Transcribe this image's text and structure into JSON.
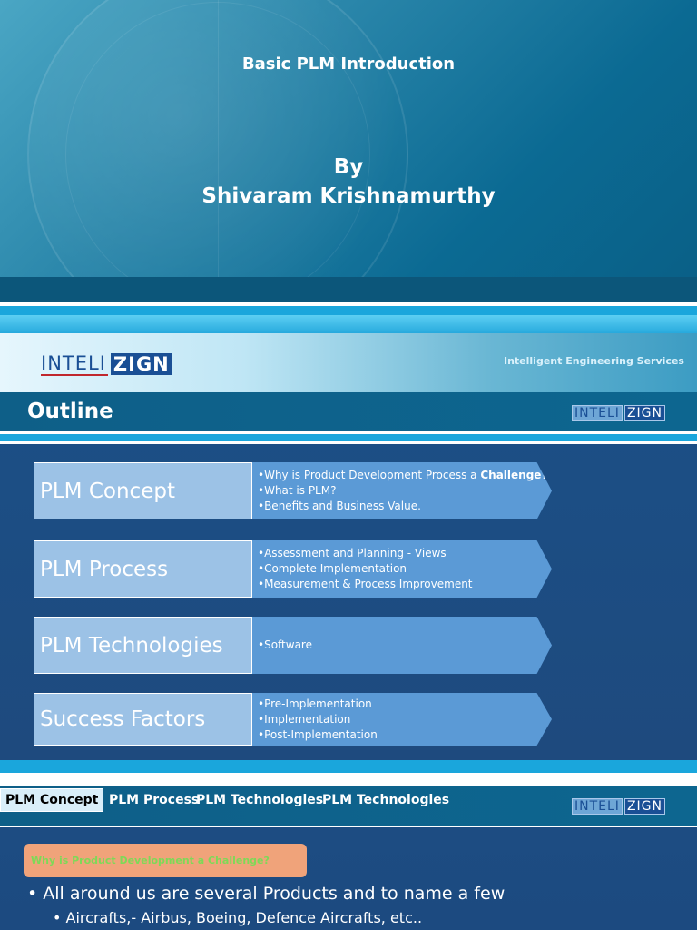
{
  "slide1": {
    "title": "Basic PLM Introduction",
    "by_label": "By",
    "author": "Shivaram Krishnamurthy"
  },
  "slide2": {
    "logo_left": "INTELI",
    "logo_right": "ZIGN",
    "tagline": "Intelligent Engineering Services",
    "title": "Outline",
    "rows": [
      {
        "label": "PLM Concept",
        "bullets": [
          {
            "pre": "•Why is Product Development Process a ",
            "bold": "Challenge",
            "post": "?"
          },
          {
            "pre": "•What is PLM?",
            "bold": "",
            "post": ""
          },
          {
            "pre": "•Benefits and Business Value.",
            "bold": "",
            "post": ""
          }
        ]
      },
      {
        "label": "PLM Process",
        "bullets": [
          {
            "pre": "•Assessment and Planning - Views",
            "bold": "",
            "post": ""
          },
          {
            "pre": "•Complete Implementation",
            "bold": "",
            "post": ""
          },
          {
            "pre": "•Measurement & Process Improvement",
            "bold": "",
            "post": ""
          }
        ]
      },
      {
        "label": "PLM Technologies",
        "bullets": [
          {
            "pre": "•Software",
            "bold": "",
            "post": ""
          }
        ]
      },
      {
        "label": "Success Factors",
        "bullets": [
          {
            "pre": "•Pre-Implementation",
            "bold": "",
            "post": ""
          },
          {
            "pre": "•Implementation",
            "bold": "",
            "post": ""
          },
          {
            "pre": "•Post-Implementation",
            "bold": "",
            "post": ""
          }
        ]
      }
    ]
  },
  "slide3": {
    "tabs": [
      "PLM Concept",
      "PLM Process",
      "PLM Technologies",
      "PLM Technologies"
    ],
    "question": "Why is Product Development a Challenge?",
    "bullet_main": "• All around us are several Products and to name a few",
    "bullet_sub": "• Aircrafts,- Airbus, Boeing, Defence Aircrafts, etc.."
  },
  "colors": {
    "band_dark": "#0c567a",
    "band_light": "#31b3e6",
    "label_box": "#9cc2e6",
    "arrow_box": "#5b9ad6",
    "question_box": "#f0a37a",
    "question_text": "#7ed957"
  }
}
